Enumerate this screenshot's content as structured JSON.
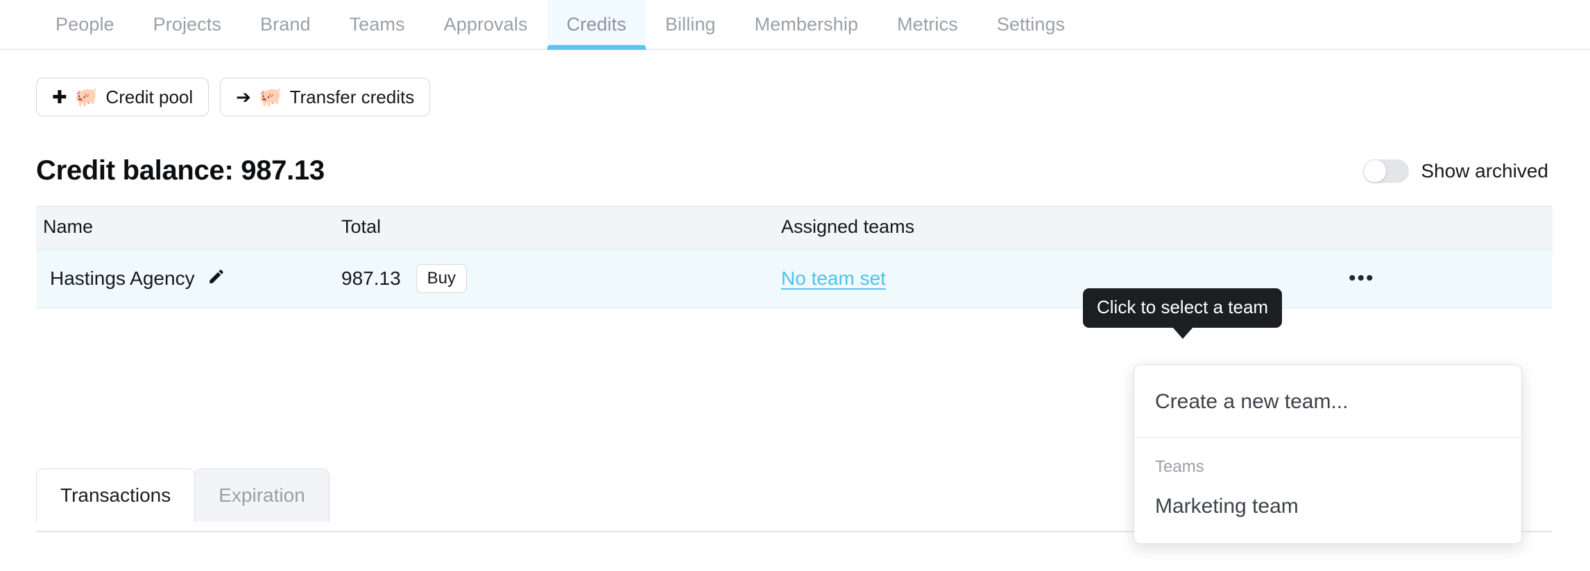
{
  "nav": {
    "tabs": [
      {
        "label": "People",
        "active": false
      },
      {
        "label": "Projects",
        "active": false
      },
      {
        "label": "Brand",
        "active": false
      },
      {
        "label": "Teams",
        "active": false
      },
      {
        "label": "Approvals",
        "active": false
      },
      {
        "label": "Credits",
        "active": true
      },
      {
        "label": "Billing",
        "active": false
      },
      {
        "label": "Membership",
        "active": false
      },
      {
        "label": "Metrics",
        "active": false
      },
      {
        "label": "Settings",
        "active": false
      }
    ],
    "active_tab": "Credits",
    "active_underline_color": "#56c5ef",
    "active_tab_bg": "#f1fafe"
  },
  "actions": {
    "credit_pool": {
      "label": "Credit pool",
      "lead_icon": "plus-icon",
      "lead_glyph": "✚",
      "pig_icon": "piggy-bank-icon",
      "pig_glyph": "🐖"
    },
    "transfer_credits": {
      "label": "Transfer credits",
      "lead_icon": "arrow-right-icon",
      "lead_glyph": "➔",
      "pig_icon": "piggy-bank-icon",
      "pig_glyph": "🐖"
    }
  },
  "balance": {
    "title": "Credit balance: 987.13",
    "amount": "987.13"
  },
  "archive": {
    "label": "Show archived",
    "enabled": false
  },
  "table": {
    "columns": [
      "Name",
      "Total",
      "Assigned teams",
      ""
    ],
    "rows": [
      {
        "name": "Hastings Agency",
        "edit_icon": "pencil-icon",
        "total": "987.13",
        "buy_label": "Buy",
        "assigned_team": "No team set",
        "more_glyph": "•••"
      }
    ]
  },
  "tooltip": {
    "text": "Click to select a team",
    "bg_color": "#1c1f22"
  },
  "dropdown": {
    "create_item": "Create a new team...",
    "group_label": "Teams",
    "teams": [
      "Marketing team"
    ]
  },
  "bottom_tabs": {
    "tabs": [
      {
        "label": "Transactions",
        "active": true
      },
      {
        "label": "Expiration",
        "active": false
      }
    ]
  },
  "colors": {
    "link": "#4cc2ee",
    "row_highlight": "#f0fafd",
    "header_bg": "#f3f4f7"
  }
}
